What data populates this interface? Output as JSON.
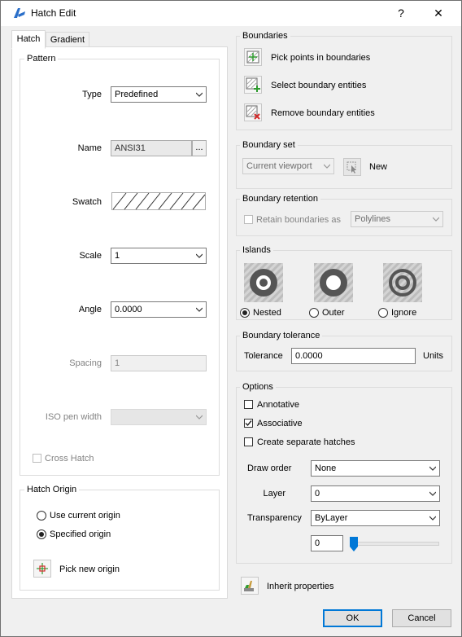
{
  "window": {
    "title": "Hatch Edit",
    "help_label": "?",
    "close_label": "✕"
  },
  "tabs": [
    {
      "label": "Hatch",
      "active": true
    },
    {
      "label": "Gradient",
      "active": false
    }
  ],
  "pattern": {
    "group_label": "Pattern",
    "type_label": "Type",
    "type_value": "Predefined",
    "name_label": "Name",
    "name_value": "ANSI31",
    "browse_label": "...",
    "swatch_label": "Swatch",
    "scale_label": "Scale",
    "scale_value": "1",
    "angle_label": "Angle",
    "angle_value": "0.0000",
    "spacing_label": "Spacing",
    "spacing_value": "1",
    "iso_label": "ISO pen width",
    "iso_value": "",
    "cross_hatch_label": "Cross Hatch"
  },
  "hatch_origin": {
    "group_label": "Hatch Origin",
    "use_current_label": "Use current origin",
    "specified_label": "Specified origin",
    "selected": "specified",
    "pick_label": "Pick new origin"
  },
  "boundaries": {
    "group_label": "Boundaries",
    "pick_points_label": "Pick points in boundaries",
    "select_entities_label": "Select boundary entities",
    "remove_entities_label": "Remove boundary entities"
  },
  "boundary_set": {
    "group_label": "Boundary set",
    "value": "Current viewport",
    "new_label": "New"
  },
  "boundary_retention": {
    "group_label": "Boundary retention",
    "retain_label": "Retain boundaries as",
    "type_value": "Polylines"
  },
  "islands": {
    "group_label": "Islands",
    "options": [
      {
        "label": "Nested",
        "selected": true,
        "icon": "nested-island-icon"
      },
      {
        "label": "Outer",
        "selected": false,
        "icon": "outer-island-icon"
      },
      {
        "label": "Ignore",
        "selected": false,
        "icon": "ignore-island-icon"
      }
    ]
  },
  "tolerance": {
    "group_label": "Boundary tolerance",
    "label": "Tolerance",
    "value": "0.0000",
    "units": "Units"
  },
  "options": {
    "group_label": "Options",
    "annotative_label": "Annotative",
    "annotative_checked": false,
    "associative_label": "Associative",
    "associative_checked": true,
    "separate_label": "Create separate hatches",
    "separate_checked": false,
    "draw_order_label": "Draw order",
    "draw_order_value": "None",
    "layer_label": "Layer",
    "layer_value": "0",
    "transparency_label": "Transparency",
    "transparency_value": "ByLayer",
    "transparency_amount": "0"
  },
  "footer": {
    "inherit_label": "Inherit properties",
    "ok_label": "OK",
    "cancel_label": "Cancel"
  },
  "colors": {
    "accent": "#0078d7",
    "pick_green": "#2e9b2e",
    "remove_red": "#d42a2a",
    "island_dark": "#555555"
  }
}
